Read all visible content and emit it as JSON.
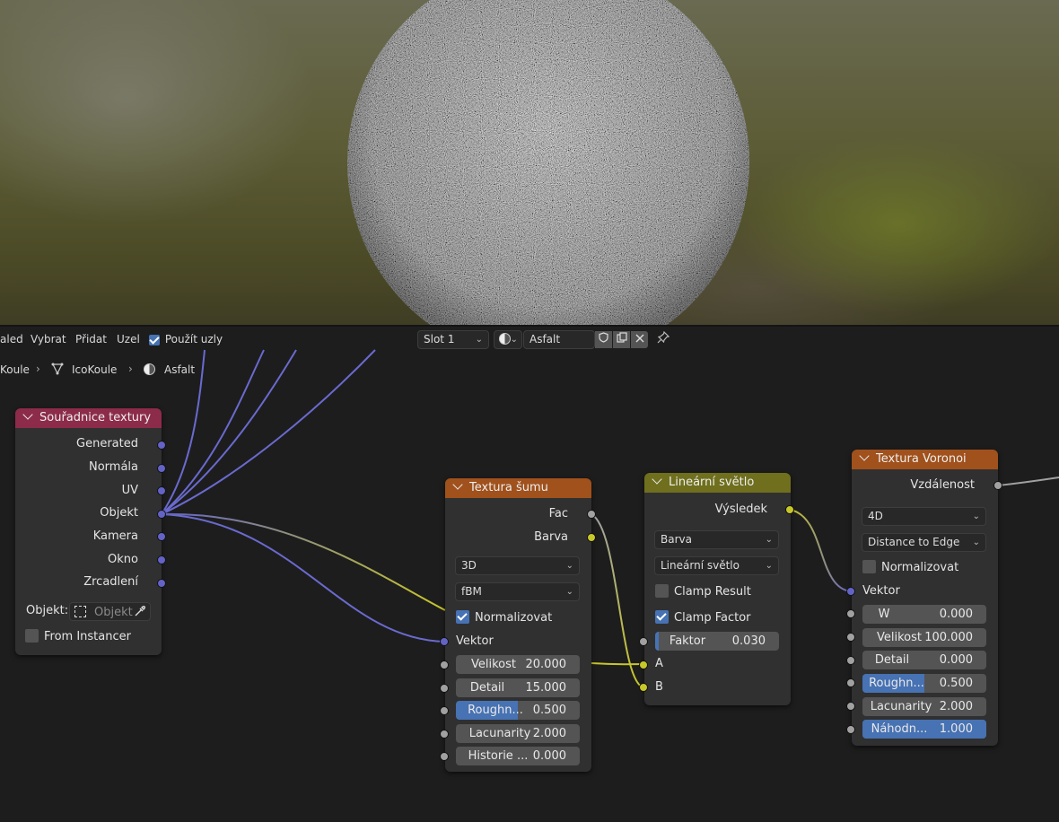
{
  "header": {
    "menu": [
      "aled",
      "Vybrat",
      "Přidat",
      "Uzel"
    ],
    "use_nodes_label": "Použít uzly",
    "use_nodes_checked": true,
    "slot": "Slot 1",
    "material_name": "Asfalt"
  },
  "breadcrumb": [
    "Koule",
    "IcoKoule",
    "Asfalt"
  ],
  "nodes": {
    "texcoord": {
      "title": "Souřadnice textury",
      "header_color": "#8c2b4a",
      "outputs": [
        "Generated",
        "Normála",
        "UV",
        "Objekt",
        "Kamera",
        "Okno",
        "Zrcadlení"
      ],
      "object_label": "Objekt:",
      "object_placeholder": "Objekt",
      "from_instancer": "From Instancer"
    },
    "noise": {
      "title": "Textura šumu",
      "header_color": "#a0511c",
      "outputs": [
        "Fac",
        "Barva"
      ],
      "dimensions": "3D",
      "type": "fBM",
      "normalize_label": "Normalizovat",
      "vector_label": "Vektor",
      "fields": [
        {
          "label": "Velikost",
          "value": "20.000"
        },
        {
          "label": "Detail",
          "value": "15.000"
        },
        {
          "label": "Roughn...",
          "value": "0.500",
          "fill": 0.5
        },
        {
          "label": "Lacunarity",
          "value": "2.000"
        },
        {
          "label": "Historie ...",
          "value": "0.000"
        }
      ]
    },
    "mix": {
      "title": "Lineární světlo",
      "header_color": "#6f6f1e",
      "output": "Výsledek",
      "data_type": "Barva",
      "blend_mode": "Lineární světlo",
      "clamp_result": "Clamp Result",
      "clamp_factor": "Clamp Factor",
      "factor_label": "Faktor",
      "factor_value": "0.030",
      "factor_fill": 0.03,
      "input_a": "A",
      "input_b": "B"
    },
    "voronoi": {
      "title": "Textura Voronoi",
      "header_color": "#a0511c",
      "output": "Vzdálenost",
      "dimensions": "4D",
      "feature": "Distance to Edge",
      "normalize_label": "Normalizovat",
      "vector_label": "Vektor",
      "fields": [
        {
          "label": "W",
          "value": "0.000"
        },
        {
          "label": "Velikost",
          "value": "100.000"
        },
        {
          "label": "Detail",
          "value": "0.000"
        },
        {
          "label": "Roughn...",
          "value": "0.500",
          "fill": 0.5
        },
        {
          "label": "Lacunarity",
          "value": "2.000"
        },
        {
          "label": "Náhodn...",
          "value": "1.000",
          "fill": 1.0
        }
      ]
    }
  },
  "colors": {
    "vector_socket": "#6363c7",
    "color_socket": "#c7c729",
    "float_socket": "#a1a1a1",
    "accent": "#4772b3"
  }
}
